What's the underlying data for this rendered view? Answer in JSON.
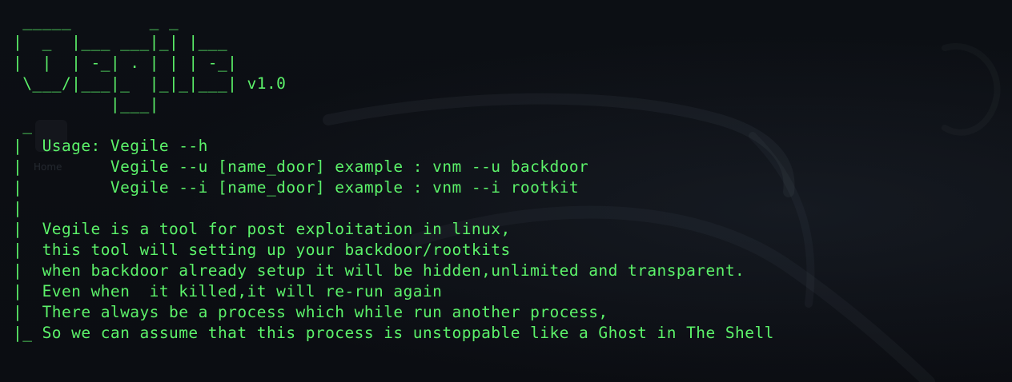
{
  "terminal": {
    "banner": [
      " _____        _ _",
      "|  _  |___ ___|_| |___",
      "|  |  | -_| . | | | -_|",
      " \\___/|___|_  |_|_|___| v1.0",
      "          |___|"
    ],
    "usage": [
      " _",
      "|  Usage: Vegile --h",
      "|         Vegile --u [name_door] example : vnm --u backdoor",
      "|         Vegile --i [name_door] example : vnm --i rootkit",
      "|"
    ],
    "description": [
      "|  Vegile is a tool for post exploitation in linux,",
      "|  this tool will setting up your backdoor/rootkits",
      "|  when backdoor already setup it will be hidden,unlimited and transparent.",
      "|  Even when  it killed,it will re-run again",
      "|  There always be a process which while run another process,",
      "|_ So we can assume that this process is unstoppable like a Ghost in The Shell"
    ]
  },
  "desktop": {
    "icon_label": "Home"
  },
  "colors": {
    "text": "#5cf26a",
    "background": "#0b0d12"
  }
}
